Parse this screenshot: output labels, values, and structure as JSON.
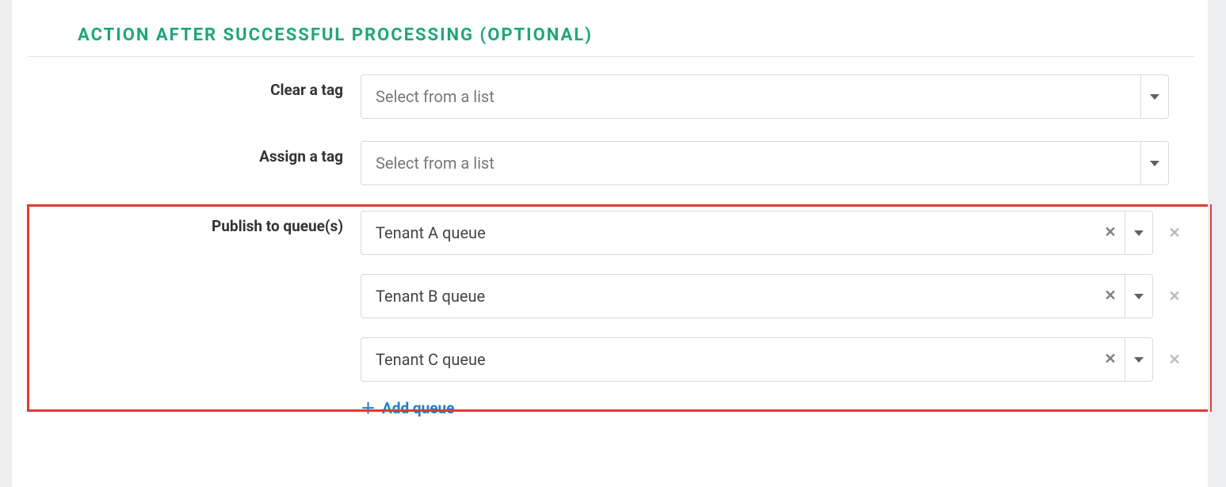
{
  "section": {
    "title": "ACTION AFTER SUCCESSFUL PROCESSING (OPTIONAL)"
  },
  "fields": {
    "clear_tag": {
      "label": "Clear a tag",
      "placeholder": "Select from a list"
    },
    "assign_tag": {
      "label": "Assign a tag",
      "placeholder": "Select from a list"
    },
    "publish_queues": {
      "label": "Publish to queue(s)",
      "items": [
        {
          "value": "Tenant A queue"
        },
        {
          "value": "Tenant B queue"
        },
        {
          "value": "Tenant C queue"
        }
      ],
      "add_label": "Add queue"
    }
  }
}
